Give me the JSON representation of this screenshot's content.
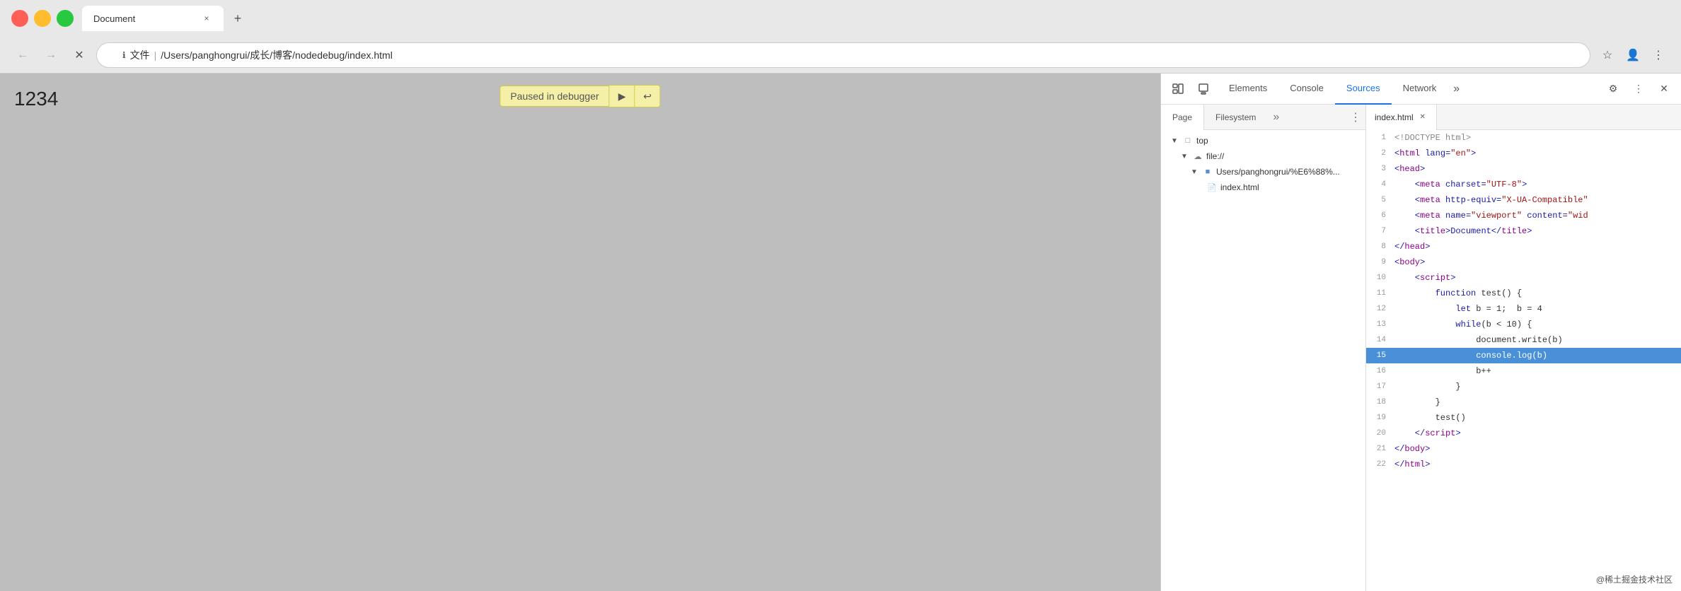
{
  "browser": {
    "tab_title": "Document",
    "new_tab_icon": "+",
    "close_icon": "×"
  },
  "address_bar": {
    "info_icon": "ℹ",
    "url_prefix": "文件",
    "url_separator": "|",
    "url_path": "/Users/panghongrui/成长/博客/nodedebug/index.html",
    "bookmark_icon": "☆",
    "profile_icon": "👤",
    "more_icon": "⋮"
  },
  "nav": {
    "back_icon": "←",
    "forward_icon": "→",
    "reload_icon": "✕"
  },
  "page": {
    "content": "1234",
    "debugger_label": "Paused in debugger",
    "resume_icon": "▶",
    "step_icon": "↩"
  },
  "devtools": {
    "inspect_icon": "⬚",
    "device_icon": "⬜",
    "tabs": [
      {
        "label": "Elements",
        "active": false
      },
      {
        "label": "Console",
        "active": false
      },
      {
        "label": "Sources",
        "active": true
      },
      {
        "label": "Network",
        "active": false
      }
    ],
    "more_tabs_icon": "»",
    "settings_icon": "⚙",
    "menu_icon": "⋮",
    "close_icon": "✕"
  },
  "sources_sidebar": {
    "tabs": [
      {
        "label": "Page",
        "active": true
      },
      {
        "label": "Filesystem",
        "active": false
      }
    ],
    "more_icon": "»",
    "menu_icon": "⋮",
    "tree": {
      "root_label": "top",
      "file_url_label": "file://",
      "folder_label": "Users/panghongrui/%E6%88%...",
      "file_label": "index.html"
    }
  },
  "editor": {
    "filename": "index.html",
    "close_icon": "✕",
    "lines": [
      {
        "num": 1,
        "tokens": [
          {
            "text": "<!DOCTYPE html>",
            "cls": "c-gray"
          }
        ]
      },
      {
        "num": 2,
        "tokens": [
          {
            "text": "<",
            "cls": "c-blue"
          },
          {
            "text": "html",
            "cls": "c-purple"
          },
          {
            "text": " lang=",
            "cls": "c-blue"
          },
          {
            "text": "\"en\"",
            "cls": "c-red"
          },
          {
            "text": ">",
            "cls": "c-blue"
          }
        ]
      },
      {
        "num": 3,
        "tokens": [
          {
            "text": "<",
            "cls": "c-blue"
          },
          {
            "text": "head",
            "cls": "c-purple"
          },
          {
            "text": ">",
            "cls": "c-blue"
          }
        ]
      },
      {
        "num": 4,
        "tokens": [
          {
            "text": "    <",
            "cls": "c-blue"
          },
          {
            "text": "meta",
            "cls": "c-purple"
          },
          {
            "text": " charset=",
            "cls": "c-blue"
          },
          {
            "text": "\"UTF-8\"",
            "cls": "c-red"
          },
          {
            "text": ">",
            "cls": "c-blue"
          }
        ]
      },
      {
        "num": 5,
        "tokens": [
          {
            "text": "    <",
            "cls": "c-blue"
          },
          {
            "text": "meta",
            "cls": "c-purple"
          },
          {
            "text": " http-equiv=",
            "cls": "c-blue"
          },
          {
            "text": "\"X-UA-Compatible\"",
            "cls": "c-red"
          }
        ]
      },
      {
        "num": 6,
        "tokens": [
          {
            "text": "    <",
            "cls": "c-blue"
          },
          {
            "text": "meta",
            "cls": "c-purple"
          },
          {
            "text": " name=",
            "cls": "c-blue"
          },
          {
            "text": "\"viewport\"",
            "cls": "c-red"
          },
          {
            "text": " content=",
            "cls": "c-blue"
          },
          {
            "text": "\"wid",
            "cls": "c-red"
          }
        ]
      },
      {
        "num": 7,
        "tokens": [
          {
            "text": "    <",
            "cls": "c-blue"
          },
          {
            "text": "title",
            "cls": "c-purple"
          },
          {
            "text": ">Document</",
            "cls": "c-blue"
          },
          {
            "text": "title",
            "cls": "c-purple"
          },
          {
            "text": ">",
            "cls": "c-blue"
          }
        ]
      },
      {
        "num": 8,
        "tokens": [
          {
            "text": "</",
            "cls": "c-blue"
          },
          {
            "text": "head",
            "cls": "c-purple"
          },
          {
            "text": ">",
            "cls": "c-blue"
          }
        ]
      },
      {
        "num": 9,
        "tokens": [
          {
            "text": "<",
            "cls": "c-blue"
          },
          {
            "text": "body",
            "cls": "c-purple"
          },
          {
            "text": ">",
            "cls": "c-blue"
          }
        ]
      },
      {
        "num": 10,
        "tokens": [
          {
            "text": "    <",
            "cls": "c-blue"
          },
          {
            "text": "script",
            "cls": "c-purple"
          },
          {
            "text": ">",
            "cls": "c-blue"
          }
        ]
      },
      {
        "num": 11,
        "tokens": [
          {
            "text": "        ",
            "cls": "c-dark"
          },
          {
            "text": "function",
            "cls": "c-blue"
          },
          {
            "text": " test() {",
            "cls": "c-dark"
          }
        ]
      },
      {
        "num": 12,
        "tokens": [
          {
            "text": "            ",
            "cls": "c-dark"
          },
          {
            "text": "let",
            "cls": "c-blue"
          },
          {
            "text": " b = 1;  ",
            "cls": "c-dark"
          },
          {
            "text": "b = 4",
            "cls": "c-dark"
          }
        ]
      },
      {
        "num": 13,
        "tokens": [
          {
            "text": "            ",
            "cls": "c-dark"
          },
          {
            "text": "while",
            "cls": "c-blue"
          },
          {
            "text": "(b < 10) {",
            "cls": "c-dark"
          }
        ]
      },
      {
        "num": 14,
        "tokens": [
          {
            "text": "                ",
            "cls": "c-dark"
          },
          {
            "text": "document.write(b)",
            "cls": "c-dark"
          }
        ]
      },
      {
        "num": 15,
        "tokens": [
          {
            "text": "                ",
            "cls": "c-white"
          },
          {
            "text": "console.",
            "cls": "c-white"
          },
          {
            "text": "log(b)",
            "cls": "c-white"
          }
        ],
        "highlighted": true
      },
      {
        "num": 16,
        "tokens": [
          {
            "text": "                ",
            "cls": "c-dark"
          },
          {
            "text": "b++",
            "cls": "c-dark"
          }
        ]
      },
      {
        "num": 17,
        "tokens": [
          {
            "text": "            }",
            "cls": "c-dark"
          }
        ]
      },
      {
        "num": 18,
        "tokens": [
          {
            "text": "        }",
            "cls": "c-dark"
          }
        ]
      },
      {
        "num": 19,
        "tokens": [
          {
            "text": "        ",
            "cls": "c-dark"
          },
          {
            "text": "test()",
            "cls": "c-dark"
          }
        ]
      },
      {
        "num": 20,
        "tokens": [
          {
            "text": "    </",
            "cls": "c-blue"
          },
          {
            "text": "script",
            "cls": "c-purple"
          },
          {
            "text": ">",
            "cls": "c-blue"
          }
        ]
      },
      {
        "num": 21,
        "tokens": [
          {
            "text": "</",
            "cls": "c-blue"
          },
          {
            "text": "body",
            "cls": "c-purple"
          },
          {
            "text": ">",
            "cls": "c-blue"
          }
        ]
      },
      {
        "num": 22,
        "tokens": [
          {
            "text": "</",
            "cls": "c-blue"
          },
          {
            "text": "html",
            "cls": "c-purple"
          },
          {
            "text": ">",
            "cls": "c-blue"
          }
        ]
      }
    ]
  },
  "watermark": {
    "text": "@稀土掘金技术社区"
  }
}
